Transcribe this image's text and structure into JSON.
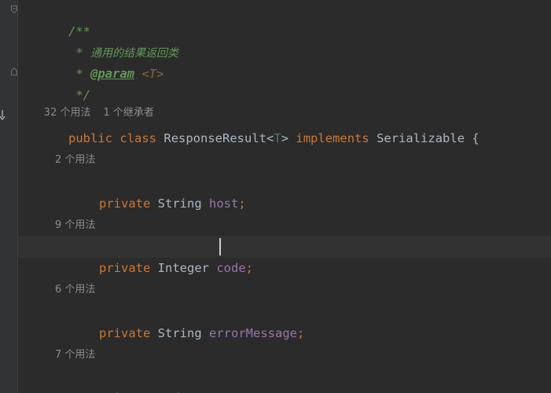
{
  "javadoc": {
    "open": "/**",
    "summary_prefix": " * ",
    "summary": "通用的结果返回类",
    "param_prefix": " * ",
    "param_tag": "@param",
    "param_space": " ",
    "param_value": "<T>",
    "close": " */"
  },
  "class_hint": {
    "usages": "32 个用法",
    "inheritors": "1 个继承者"
  },
  "class_decl": {
    "kw_public": "public",
    "sp1": " ",
    "kw_class": "class",
    "sp2": " ",
    "name": "ResponseResult",
    "lt": "<",
    "tparam": "T",
    "gt": ">",
    "sp3": " ",
    "kw_implements": "implements",
    "sp4": " ",
    "iface": "Serializable",
    "brace": " {"
  },
  "fields": [
    {
      "hint": "2 个用法",
      "modifier": "private",
      "type": "String",
      "name": "host",
      "semicolon": ";"
    },
    {
      "hint": "9 个用法",
      "modifier": "private",
      "type": "Integer",
      "name": "code",
      "semicolon": ";"
    },
    {
      "hint": "6 个用法",
      "modifier": "private",
      "type": "String",
      "name": "errorMessage",
      "semicolon": ";"
    },
    {
      "hint": "7 个用法",
      "modifier": "private",
      "type": "T",
      "name": "data",
      "semicolon": ";"
    }
  ],
  "colors": {
    "background": "#2b2b2b",
    "keyword": "#cc7832",
    "field": "#9876aa",
    "doc_comment": "#629755",
    "type_param": "#507874",
    "text": "#a9b7c6",
    "hint": "#8c8c8c"
  },
  "icons": [
    "fold-open-icon",
    "fold-close-icon",
    "implemented-by-icon"
  ]
}
